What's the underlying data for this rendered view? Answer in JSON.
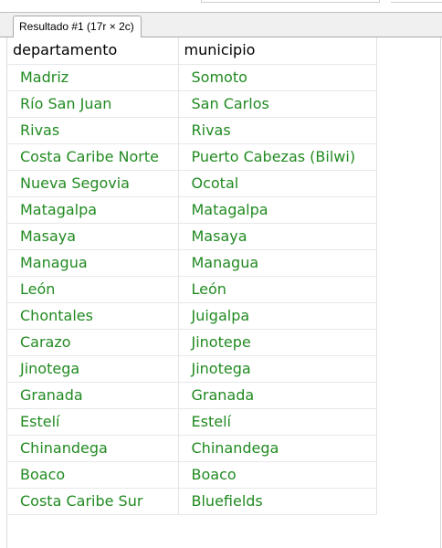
{
  "tab": {
    "label": "Resultado #1 (17r × 2c)"
  },
  "table": {
    "columns": [
      "departamento",
      "municipio"
    ],
    "rows": [
      [
        "Madriz",
        "Somoto"
      ],
      [
        "Río San Juan",
        "San Carlos"
      ],
      [
        "Rivas",
        "Rivas"
      ],
      [
        "Costa Caribe Norte",
        "Puerto Cabezas (Bilwi)"
      ],
      [
        "Nueva Segovia",
        "Ocotal"
      ],
      [
        "Matagalpa",
        "Matagalpa"
      ],
      [
        "Masaya",
        "Masaya"
      ],
      [
        "Managua",
        "Managua"
      ],
      [
        "León",
        "León"
      ],
      [
        "Chontales",
        "Juigalpa"
      ],
      [
        "Carazo",
        "Jinotepe"
      ],
      [
        "Jinotega",
        "Jinotega"
      ],
      [
        "Granada",
        "Granada"
      ],
      [
        "Estelí",
        "Estelí"
      ],
      [
        "Chinandega",
        "Chinandega"
      ],
      [
        "Boaco",
        "Boaco"
      ],
      [
        "Costa Caribe Sur",
        "Bluefields"
      ]
    ]
  },
  "colors": {
    "cell_text": "#218a21",
    "header_text": "#000000",
    "grid_line": "#e3e3e3"
  }
}
